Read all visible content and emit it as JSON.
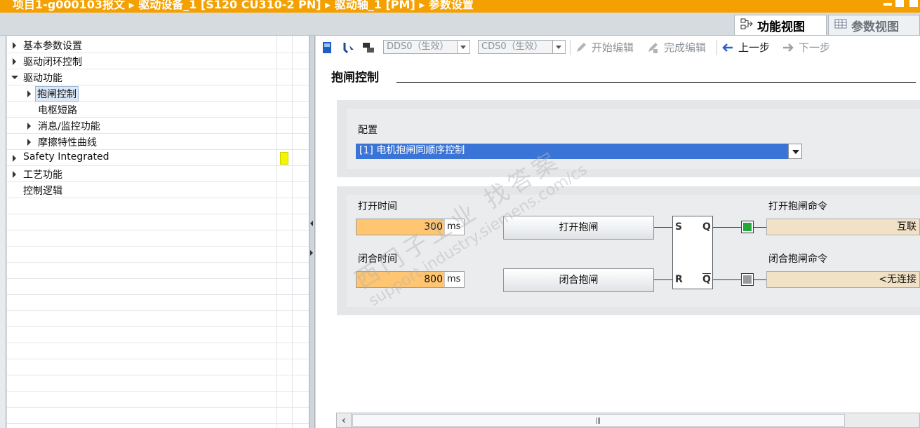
{
  "title_bar": {
    "text": "项目1-g000103报文 ▸ 驱动设备_1 [S120 CU310-2 PN] ▸ 驱动轴_1 [PM] ▸ 参数设置"
  },
  "view_tabs": [
    {
      "label": "功能视图",
      "icon": "function-view-icon",
      "active": true
    },
    {
      "label": "参数视图",
      "icon": "parameter-view-icon",
      "active": false
    }
  ],
  "tree": {
    "items": [
      {
        "label": "基本参数设置",
        "expander": "collapsed",
        "level": 0
      },
      {
        "label": "驱动闭环控制",
        "expander": "collapsed",
        "level": 0
      },
      {
        "label": "驱动功能",
        "expander": "expanded",
        "level": 0
      },
      {
        "label": "抱闸控制",
        "expander": "collapsed",
        "level": 1,
        "selected": true
      },
      {
        "label": "电枢短路",
        "expander": "none",
        "level": 1
      },
      {
        "label": "消息/监控功能",
        "expander": "collapsed",
        "level": 1
      },
      {
        "label": "摩擦特性曲线",
        "expander": "collapsed",
        "level": 1
      },
      {
        "label": "Safety Integrated",
        "expander": "collapsed",
        "level": 0,
        "marker": "yellow"
      },
      {
        "label": "工艺功能",
        "expander": "collapsed",
        "level": 0
      },
      {
        "label": "控制逻辑",
        "expander": "none",
        "level": 0
      }
    ]
  },
  "toolbar": {
    "dds_combo": "DDS0（生效）",
    "cds_combo": "CDS0（生效）",
    "start_edit": "开始编辑",
    "finish_edit": "完成编辑",
    "prev_step": "上一步",
    "next_step": "下一步"
  },
  "section": {
    "title": "抱闸控制"
  },
  "config": {
    "label": "配置",
    "selected": "[1] 电机抱闸同顺序控制"
  },
  "brake": {
    "open_time_label": "打开时间",
    "open_time_value": "300",
    "open_time_unit": "ms",
    "close_time_label": "闭合时间",
    "close_time_value": "800",
    "close_time_unit": "ms",
    "open_button": "打开抱闸",
    "close_button": "闭合抱闸",
    "ff_s": "S",
    "ff_r": "R",
    "ff_q": "Q",
    "ff_qbar": "Q",
    "open_cmd_label": "打开抱闸命令",
    "open_cmd_value": "互联",
    "close_cmd_label": "闭合抱闸命令",
    "close_cmd_value": "<无连接",
    "led_open_color": "#22a83a",
    "led_close_color": "#9a9a9a"
  },
  "watermark": {
    "line1": "西门子工业   找答案",
    "line2": "support.industry.siemens.com/cs"
  }
}
